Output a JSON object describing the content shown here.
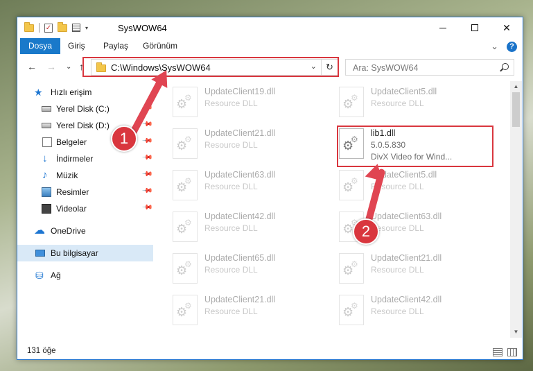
{
  "window": {
    "title": "SysWOW64",
    "qat_dropdown": "▾",
    "minimize": "",
    "close": "✕"
  },
  "ribbon": {
    "tabs": [
      {
        "label": "Dosya",
        "active": true
      },
      {
        "label": "Giriş"
      },
      {
        "label": "Paylaş"
      },
      {
        "label": "Görünüm"
      }
    ],
    "expand": "⌄"
  },
  "nav": {
    "back": "←",
    "forward": "→",
    "recent": "⌄",
    "up": "↑",
    "address": "C:\\Windows\\SysWOW64",
    "address_dropdown": "⌄",
    "refresh": "↻",
    "search_placeholder": "Ara: SysWOW64"
  },
  "sidebar": {
    "items": [
      {
        "label": "Hızlı erişim",
        "icon": "star-icon"
      },
      {
        "label": "Yerel Disk (C:)",
        "icon": "disk-icon",
        "pinned": true
      },
      {
        "label": "Yerel Disk (D:)",
        "icon": "disk-icon",
        "pinned": true
      },
      {
        "label": "Belgeler",
        "icon": "documents-icon",
        "pinned": true
      },
      {
        "label": "İndirmeler",
        "icon": "downloads-icon",
        "pinned": true
      },
      {
        "label": "Müzik",
        "icon": "music-icon",
        "pinned": true
      },
      {
        "label": "Resimler",
        "icon": "pictures-icon",
        "pinned": true
      },
      {
        "label": "Videolar",
        "icon": "videos-icon",
        "pinned": true
      },
      {
        "label": "OneDrive",
        "icon": "cloud-icon"
      },
      {
        "label": "Bu bilgisayar",
        "icon": "computer-icon",
        "selected": true
      },
      {
        "label": "Ağ",
        "icon": "network-icon"
      }
    ],
    "pin_glyph": "📌"
  },
  "files": {
    "left": [
      {
        "name": "UpdateClient19.dll",
        "type": "Resource DLL"
      },
      {
        "name": "UpdateClient21.dll",
        "type": "Resource DLL"
      },
      {
        "name": "UpdateClient63.dll",
        "type": "Resource DLL"
      },
      {
        "name": "UpdateClient42.dll",
        "type": "Resource DLL"
      },
      {
        "name": "UpdateClient65.dll",
        "type": "Resource DLL"
      },
      {
        "name": "UpdateClient21.dll",
        "type": "Resource DLL"
      }
    ],
    "right": [
      {
        "name": "UpdateClient5.dll",
        "type": "Resource DLL"
      },
      {
        "name": "lib1.dll",
        "version": "5.0.5.830",
        "type": "DivX Video for Wind...",
        "highlight": true
      },
      {
        "name": "UpdateClient5.dll",
        "type": "Resource DLL"
      },
      {
        "name": "UpdateClient63.dll",
        "type": "Resource DLL"
      },
      {
        "name": "UpdateClient21.dll",
        "type": "Resource DLL"
      },
      {
        "name": "UpdateClient42.dll",
        "type": "Resource DLL"
      }
    ]
  },
  "status": {
    "count": "131 öğe"
  },
  "annotations": {
    "step1": "1",
    "step2": "2",
    "color": "#d9363e"
  }
}
